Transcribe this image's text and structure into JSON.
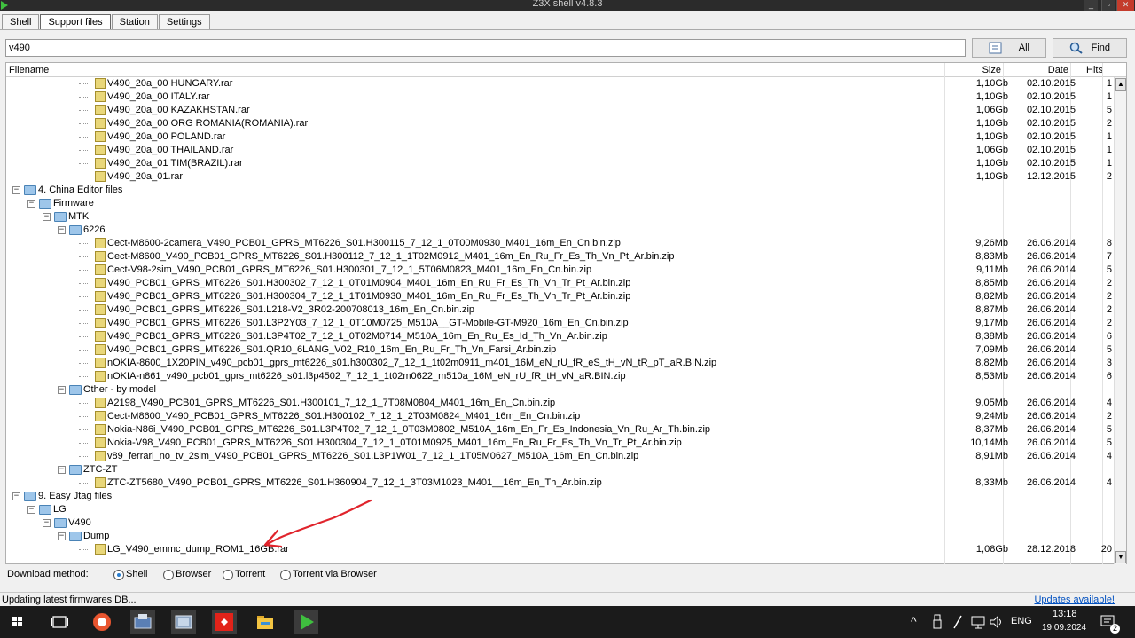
{
  "window": {
    "title": "Z3X shell v4.8.3"
  },
  "tabs": [
    {
      "label": "Shell",
      "active": false
    },
    {
      "label": "Support files",
      "active": true
    },
    {
      "label": "Station",
      "active": false
    },
    {
      "label": "Settings",
      "active": false
    }
  ],
  "search": {
    "value": "v490",
    "all_label": "All",
    "find_label": "Find"
  },
  "columns": {
    "filename": "Filename",
    "size": "Size",
    "date": "Date",
    "hits": "Hits"
  },
  "rows": [
    {
      "level": 5,
      "kind": "file",
      "name": "V490_20a_00 HUNGARY.rar",
      "size": "1,10Gb",
      "date": "02.10.2015",
      "hits": "1"
    },
    {
      "level": 5,
      "kind": "file",
      "name": "V490_20a_00 ITALY.rar",
      "size": "1,10Gb",
      "date": "02.10.2015",
      "hits": "1"
    },
    {
      "level": 5,
      "kind": "file",
      "name": "V490_20a_00 KAZAKHSTAN.rar",
      "size": "1,06Gb",
      "date": "02.10.2015",
      "hits": "5"
    },
    {
      "level": 5,
      "kind": "file",
      "name": "V490_20a_00 ORG ROMANIA(ROMANIA).rar",
      "size": "1,10Gb",
      "date": "02.10.2015",
      "hits": "2"
    },
    {
      "level": 5,
      "kind": "file",
      "name": "V490_20a_00 POLAND.rar",
      "size": "1,10Gb",
      "date": "02.10.2015",
      "hits": "1"
    },
    {
      "level": 5,
      "kind": "file",
      "name": "V490_20a_00 THAILAND.rar",
      "size": "1,06Gb",
      "date": "02.10.2015",
      "hits": "1"
    },
    {
      "level": 5,
      "kind": "file",
      "name": "V490_20a_01 TIM(BRAZIL).rar",
      "size": "1,10Gb",
      "date": "02.10.2015",
      "hits": "1"
    },
    {
      "level": 5,
      "kind": "file",
      "name": "V490_20a_01.rar",
      "size": "1,10Gb",
      "date": "12.12.2015",
      "hits": "2"
    },
    {
      "level": 0,
      "kind": "folder",
      "name": "4. China Editor files",
      "size": "",
      "date": "",
      "hits": ""
    },
    {
      "level": 1,
      "kind": "folder",
      "name": "Firmware",
      "size": "",
      "date": "",
      "hits": ""
    },
    {
      "level": 2,
      "kind": "folder",
      "name": "MTK",
      "size": "",
      "date": "",
      "hits": ""
    },
    {
      "level": 3,
      "kind": "folder",
      "name": "6226",
      "size": "",
      "date": "",
      "hits": ""
    },
    {
      "level": 5,
      "kind": "file",
      "name": "Cect-M8600-2camera_V490_PCB01_GPRS_MT6226_S01.H300115_7_12_1_0T00M0930_M401_16m_En_Cn.bin.zip",
      "size": "9,26Mb",
      "date": "26.06.2014",
      "hits": "8"
    },
    {
      "level": 5,
      "kind": "file",
      "name": "Cect-M8600_V490_PCB01_GPRS_MT6226_S01.H300112_7_12_1_1T02M0912_M401_16m_En_Ru_Fr_Es_Th_Vn_Pt_Ar.bin.zip",
      "size": "8,83Mb",
      "date": "26.06.2014",
      "hits": "7"
    },
    {
      "level": 5,
      "kind": "file",
      "name": "Cect-V98-2sim_V490_PCB01_GPRS_MT6226_S01.H300301_7_12_1_5T06M0823_M401_16m_En_Cn.bin.zip",
      "size": "9,11Mb",
      "date": "26.06.2014",
      "hits": "5"
    },
    {
      "level": 5,
      "kind": "file",
      "name": "V490_PCB01_GPRS_MT6226_S01.H300302_7_12_1_0T01M0904_M401_16m_En_Ru_Fr_Es_Th_Vn_Tr_Pt_Ar.bin.zip",
      "size": "8,85Mb",
      "date": "26.06.2014",
      "hits": "2"
    },
    {
      "level": 5,
      "kind": "file",
      "name": "V490_PCB01_GPRS_MT6226_S01.H300304_7_12_1_1T01M0930_M401_16m_En_Ru_Fr_Es_Th_Vn_Tr_Pt_Ar.bin.zip",
      "size": "8,82Mb",
      "date": "26.06.2014",
      "hits": "2"
    },
    {
      "level": 5,
      "kind": "file",
      "name": "V490_PCB01_GPRS_MT6226_S01.L218-V2_3R02-200708013_16m_En_Cn.bin.zip",
      "size": "8,87Mb",
      "date": "26.06.2014",
      "hits": "2"
    },
    {
      "level": 5,
      "kind": "file",
      "name": "V490_PCB01_GPRS_MT6226_S01.L3P2Y03_7_12_1_0T10M0725_M510A__GT-Mobile-GT-M920_16m_En_Cn.bin.zip",
      "size": "9,17Mb",
      "date": "26.06.2014",
      "hits": "2"
    },
    {
      "level": 5,
      "kind": "file",
      "name": "V490_PCB01_GPRS_MT6226_S01.L3P4T02_7_12_1_0T02M0714_M510A_16m_En_Ru_Es_Id_Th_Vn_Ar.bin.zip",
      "size": "8,38Mb",
      "date": "26.06.2014",
      "hits": "6"
    },
    {
      "level": 5,
      "kind": "file",
      "name": "V490_PCB01_GPRS_MT6226_S01.QR10_6LANG_V02_R10_16m_En_Ru_Fr_Th_Vn_Farsi_Ar.bin.zip",
      "size": "7,09Mb",
      "date": "26.06.2014",
      "hits": "5"
    },
    {
      "level": 5,
      "kind": "file",
      "name": "nOKIA-8600_1X20PIN_v490_pcb01_gprs_mt6226_s01.h300302_7_12_1_1t02m0911_m401_16M_eN_rU_fR_eS_tH_vN_tR_pT_aR.BIN.zip",
      "size": "8,82Mb",
      "date": "26.06.2014",
      "hits": "3"
    },
    {
      "level": 5,
      "kind": "file",
      "name": "nOKIA-n861_v490_pcb01_gprs_mt6226_s01.l3p4502_7_12_1_1t02m0622_m510a_16M_eN_rU_fR_tH_vN_aR.BIN.zip",
      "size": "8,53Mb",
      "date": "26.06.2014",
      "hits": "6"
    },
    {
      "level": 3,
      "kind": "folder",
      "name": "Other - by model",
      "size": "",
      "date": "",
      "hits": ""
    },
    {
      "level": 5,
      "kind": "file",
      "name": "A2198_V490_PCB01_GPRS_MT6226_S01.H300101_7_12_1_7T08M0804_M401_16m_En_Cn.bin.zip",
      "size": "9,05Mb",
      "date": "26.06.2014",
      "hits": "4"
    },
    {
      "level": 5,
      "kind": "file",
      "name": "Cect-M8600_V490_PCB01_GPRS_MT6226_S01.H300102_7_12_1_2T03M0824_M401_16m_En_Cn.bin.zip",
      "size": "9,24Mb",
      "date": "26.06.2014",
      "hits": "2"
    },
    {
      "level": 5,
      "kind": "file",
      "name": "Nokia-N86i_V490_PCB01_GPRS_MT6226_S01.L3P4T02_7_12_1_0T03M0802_M510A_16m_En_Fr_Es_Indonesia_Vn_Ru_Ar_Th.bin.zip",
      "size": "8,37Mb",
      "date": "26.06.2014",
      "hits": "5"
    },
    {
      "level": 5,
      "kind": "file",
      "name": "Nokia-V98_V490_PCB01_GPRS_MT6226_S01.H300304_7_12_1_0T01M0925_M401_16m_En_Ru_Fr_Es_Th_Vn_Tr_Pt_Ar.bin.zip",
      "size": "10,14Mb",
      "date": "26.06.2014",
      "hits": "5"
    },
    {
      "level": 5,
      "kind": "file",
      "name": "v89_ferrari_no_tv_2sim_V490_PCB01_GPRS_MT6226_S01.L3P1W01_7_12_1_1T05M0627_M510A_16m_En_Cn.bin.zip",
      "size": "8,91Mb",
      "date": "26.06.2014",
      "hits": "4"
    },
    {
      "level": 3,
      "kind": "folder",
      "name": "ZTC-ZT",
      "size": "",
      "date": "",
      "hits": ""
    },
    {
      "level": 5,
      "kind": "file",
      "name": "ZTC-ZT5680_V490_PCB01_GPRS_MT6226_S01.H360904_7_12_1_3T03M1023_M401__16m_En_Th_Ar.bin.zip",
      "size": "8,33Mb",
      "date": "26.06.2014",
      "hits": "4"
    },
    {
      "level": 0,
      "kind": "folder",
      "name": "9. Easy Jtag files",
      "size": "",
      "date": "",
      "hits": ""
    },
    {
      "level": 1,
      "kind": "folder",
      "name": "LG",
      "size": "",
      "date": "",
      "hits": ""
    },
    {
      "level": 2,
      "kind": "folder",
      "name": "V490",
      "size": "",
      "date": "",
      "hits": ""
    },
    {
      "level": 3,
      "kind": "folder",
      "name": "Dump",
      "size": "",
      "date": "",
      "hits": ""
    },
    {
      "level": 5,
      "kind": "file",
      "name": "LG_V490_emmc_dump_ROM1_16GB.rar",
      "size": "1,08Gb",
      "date": "28.12.2018",
      "hits": "20"
    }
  ],
  "download": {
    "label": "Download method:",
    "options": [
      {
        "label": "Shell",
        "selected": true
      },
      {
        "label": "Browser",
        "selected": false
      },
      {
        "label": "Torrent",
        "selected": false
      },
      {
        "label": "Torrent via Browser",
        "selected": false
      }
    ]
  },
  "status": {
    "text": "Updating latest firmwares DB...",
    "updates_link": "Updates available!"
  },
  "taskbar": {
    "lang": "ENG",
    "time": "13:18",
    "date": "19.09.2024",
    "notifications": "2"
  }
}
